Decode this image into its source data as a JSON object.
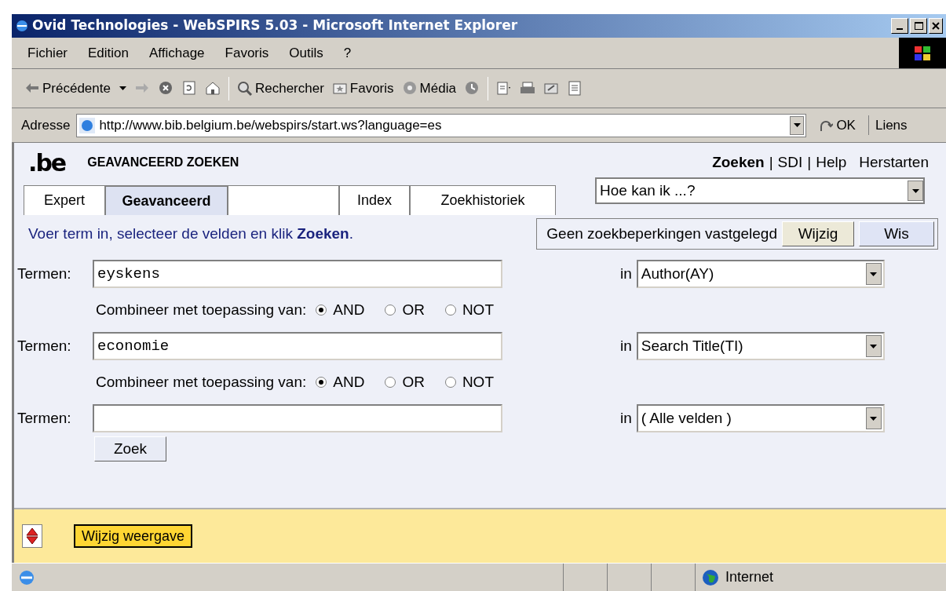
{
  "window": {
    "title": "Ovid Technologies - WebSPIRS 5.03 - Microsoft Internet Explorer"
  },
  "menu": [
    {
      "label": "Fichier"
    },
    {
      "label": "Edition"
    },
    {
      "label": "Affichage"
    },
    {
      "label": "Favoris"
    },
    {
      "label": "Outils"
    },
    {
      "label": "?"
    }
  ],
  "toolbar": [
    {
      "kind": "back",
      "label": "Précédente"
    },
    {
      "kind": "forward"
    },
    {
      "kind": "stop"
    },
    {
      "kind": "refresh"
    },
    {
      "kind": "home"
    },
    {
      "kind": "sep"
    },
    {
      "kind": "search",
      "label": "Rechercher"
    },
    {
      "kind": "favorites",
      "label": "Favoris"
    },
    {
      "kind": "media",
      "label": "Média"
    },
    {
      "kind": "history"
    },
    {
      "kind": "sep"
    },
    {
      "kind": "edit"
    },
    {
      "kind": "print"
    },
    {
      "kind": "mail"
    },
    {
      "kind": "page"
    }
  ],
  "address": {
    "label": "Adresse",
    "url": "http://www.bib.belgium.be/webspirs/start.ws?language=es",
    "go": "OK",
    "links": "Liens"
  },
  "page": {
    "logo": ".be",
    "heading": "GEAVANCEERD ZOEKEN",
    "top_links": [
      {
        "kind": "link",
        "label": "Zoeken",
        "selected": true
      },
      {
        "kind": "sep",
        "label": "|"
      },
      {
        "kind": "link",
        "label": "SDI",
        "selected": false
      },
      {
        "kind": "sep",
        "label": "|"
      },
      {
        "kind": "link",
        "label": "Help",
        "selected": false
      },
      {
        "kind": "link",
        "label": "Herstarten",
        "selected": false
      }
    ],
    "tabs": [
      {
        "label": "Expert",
        "selected": false
      },
      {
        "label": "Geavanceerd",
        "selected": true
      },
      {
        "selected": false
      },
      {
        "label": "Index",
        "selected": false
      },
      {
        "label": "Zoekhistoriek",
        "selected": false
      }
    ],
    "help_select": "Hoe kan ik ...?",
    "instruction": "Voer term in, selecteer de velden en klik **Zoeken**.",
    "limits": {
      "text": "Geen zoekbeperkingen vastgelegd",
      "buttons": [
        "Wijzig",
        "Wis"
      ]
    },
    "rows": [
      {
        "kind": "term",
        "label": "Termen:",
        "value": "eyskens",
        "in": "in",
        "field": "Author(AY)"
      },
      {
        "kind": "combine",
        "label": "Combineer met toepassing van:",
        "options": [
          {
            "label": "AND",
            "selected": true
          },
          {
            "label": "OR",
            "selected": false
          },
          {
            "label": "NOT",
            "selected": false
          }
        ]
      },
      {
        "kind": "term",
        "label": "Termen:",
        "value": "economie",
        "in": "in",
        "field": "Search Title(TI)"
      },
      {
        "kind": "combine",
        "label": "Combineer met toepassing van:",
        "options": [
          {
            "label": "AND",
            "selected": true
          },
          {
            "label": "OR",
            "selected": false
          },
          {
            "label": "NOT",
            "selected": false
          }
        ]
      },
      {
        "kind": "term",
        "label": "Termen:",
        "in": "in",
        "field": "( Alle velden )"
      }
    ],
    "search_button": "Zoek",
    "footer_button": "Wijzig weergave"
  },
  "status_bar": {
    "zone": "Internet"
  }
}
